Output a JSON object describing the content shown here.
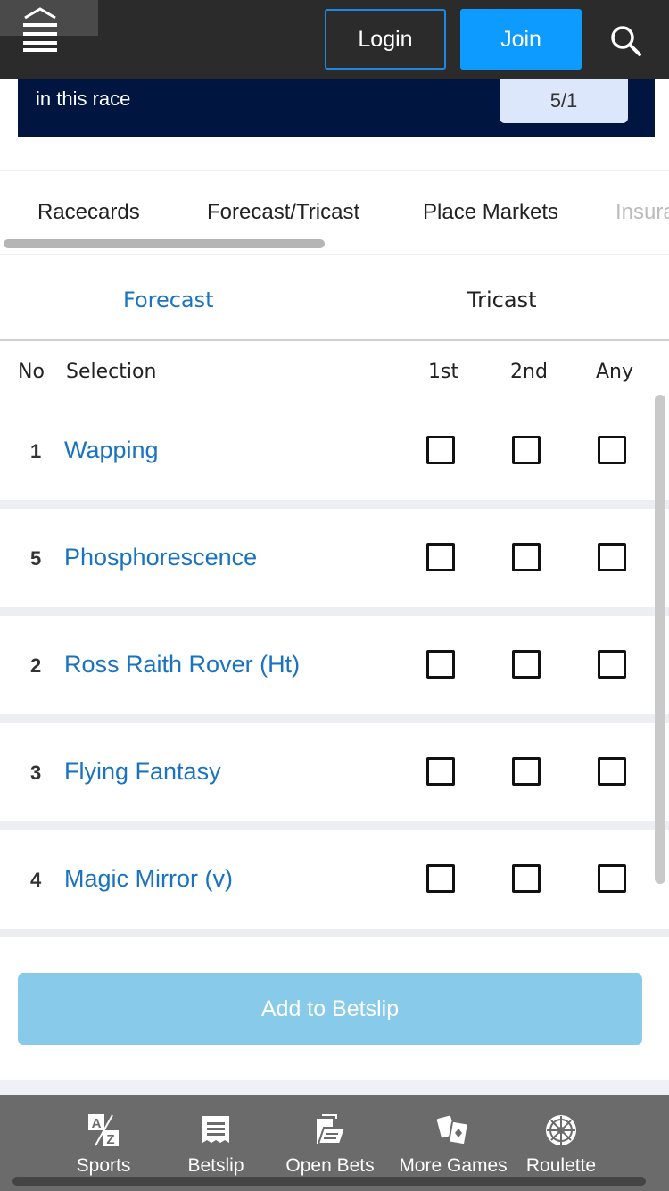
{
  "header": {
    "login_label": "Login",
    "join_label": "Join",
    "menu_icon": "hamburger-home-icon",
    "search_icon": "search-icon",
    "colors": {
      "bar": "#2b2b2b",
      "join": "#0d9bff",
      "login_border": "#1e88e5"
    }
  },
  "promo": {
    "text": "in this race",
    "odds": "5/1"
  },
  "tabs": {
    "items": [
      {
        "label": "Racecards"
      },
      {
        "label": "Forecast/Tricast"
      },
      {
        "label": "Place Markets"
      },
      {
        "label": "Insura"
      }
    ]
  },
  "subtabs": {
    "forecast": "Forecast",
    "tricast": "Tricast",
    "active": "Forecast"
  },
  "columns": {
    "no": "No",
    "selection": "Selection",
    "first": "1st",
    "second": "2nd",
    "any": "Any"
  },
  "runners": [
    {
      "no": "1",
      "name": "Wapping"
    },
    {
      "no": "5",
      "name": "Phosphorescence"
    },
    {
      "no": "2",
      "name": "Ross Raith Rover (Ht)"
    },
    {
      "no": "3",
      "name": "Flying Fantasy"
    },
    {
      "no": "4",
      "name": "Magic Mirror (v)"
    }
  ],
  "add_button": "Add to Betslip",
  "bottom_nav": [
    {
      "label": "Sports",
      "icon": "az-sports-icon"
    },
    {
      "label": "Betslip",
      "icon": "betslip-icon"
    },
    {
      "label": "Open Bets",
      "icon": "open-bets-icon"
    },
    {
      "label": "More Games",
      "icon": "cards-icon"
    },
    {
      "label": "Roulette",
      "icon": "roulette-wheel-icon"
    }
  ]
}
